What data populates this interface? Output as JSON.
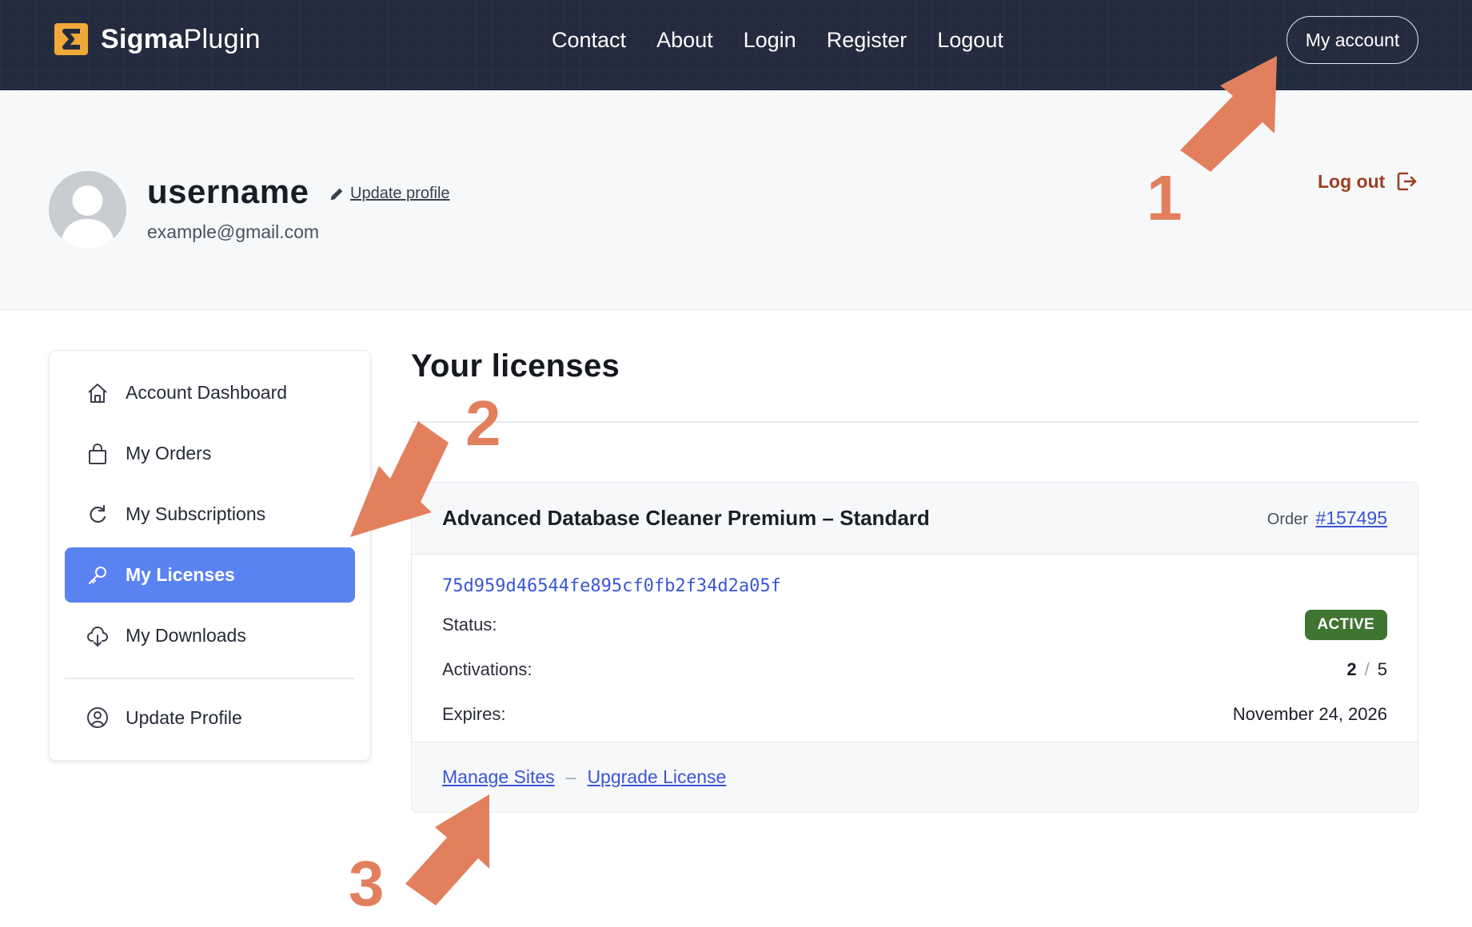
{
  "header": {
    "logo_bold": "Sigma",
    "logo_regular": "Plugin",
    "nav": [
      "Contact",
      "About",
      "Login",
      "Register",
      "Logout"
    ],
    "account_button": "My account"
  },
  "profile": {
    "username": "username",
    "update_label": "Update profile",
    "email": "example@gmail.com",
    "logout_label": "Log out"
  },
  "sidebar": {
    "items": [
      {
        "label": "Account Dashboard",
        "icon": "home-icon"
      },
      {
        "label": "My Orders",
        "icon": "bag-icon"
      },
      {
        "label": "My Subscriptions",
        "icon": "refresh-icon"
      },
      {
        "label": "My Licenses",
        "icon": "key-icon",
        "active": true
      },
      {
        "label": "My Downloads",
        "icon": "cloud-download-icon"
      },
      {
        "label": "Update Profile",
        "icon": "user-circle-icon"
      }
    ]
  },
  "main": {
    "title": "Your licenses",
    "license": {
      "product": "Advanced Database Cleaner Premium – Standard",
      "order_label": "Order",
      "order_number": "#157495",
      "key": "75d959d46544fe895cf0fb2f34d2a05f",
      "status_label": "Status:",
      "status_value": "ACTIVE",
      "activations_label": "Activations:",
      "activations_used": "2",
      "activations_slash": "/",
      "activations_total": "5",
      "expires_label": "Expires:",
      "expires_value": "November 24, 2026",
      "manage_sites": "Manage Sites",
      "separator": "–",
      "upgrade": "Upgrade License"
    }
  },
  "annotations": {
    "step_1": "1",
    "step_2": "2",
    "step_3": "3",
    "arrow_color": "#e2805e"
  },
  "colors": {
    "header_bg": "#232b3e",
    "accent_active": "#5b82f1",
    "link": "#3a56d4",
    "status_active": "#3f7530",
    "logout": "#9b3f22"
  }
}
